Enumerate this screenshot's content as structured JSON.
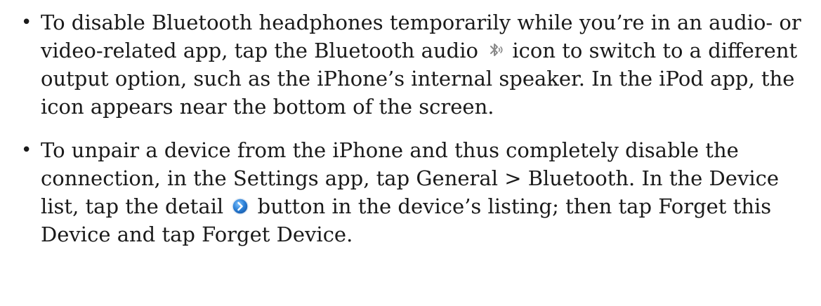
{
  "bullet_symbol": "•",
  "items": [
    {
      "before_icon": "To disable Bluetooth headphones temporarily while you’re in an audio- or video-related app, tap the Bluetooth audio ",
      "icon": "bluetooth-audio-icon",
      "after_icon": " icon to switch to a different output option, such as the iPhone’s internal speaker. In the iPod app, the icon appears near the bottom of the screen."
    },
    {
      "before_icon": "To unpair a device from the iPhone and thus completely disable the connection, in the Settings app, tap General > Bluetooth. In the Device list, tap the detail ",
      "icon": "detail-disclosure-icon",
      "after_icon": " button in the device’s listing; then tap Forget this Device and tap Forget Device."
    }
  ],
  "colors": {
    "text": "#1a1a1a",
    "detail_icon_blue": "#2a7fd6",
    "bluetooth_icon_gray": "#8a8a8a"
  }
}
